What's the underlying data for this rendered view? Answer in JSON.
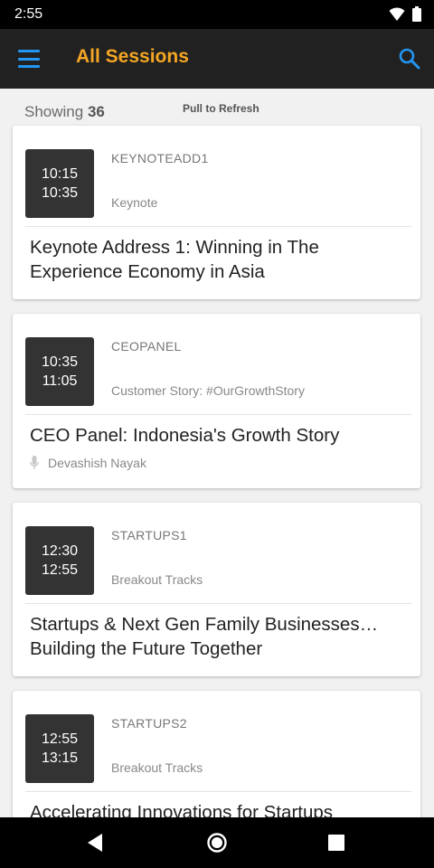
{
  "status": {
    "time": "2:55"
  },
  "app": {
    "title": "All Sessions"
  },
  "list": {
    "showing_label": "Showing",
    "count": "36",
    "pull_refresh": "Pull to Refresh"
  },
  "sessions": [
    {
      "start": "10:15",
      "end": "10:35",
      "code": "KEYNOTEADD1",
      "track": "Keynote",
      "title": "Keynote Address 1: Winning in The Experience Economy in Asia",
      "speaker": ""
    },
    {
      "start": "10:35",
      "end": "11:05",
      "code": "CEOPANEL",
      "track": "Customer Story: #OurGrowthStory",
      "title": "CEO Panel: Indonesia's Growth Story",
      "speaker": "Devashish Nayak"
    },
    {
      "start": "12:30",
      "end": "12:55",
      "code": "STARTUPS1",
      "track": "Breakout Tracks",
      "title": "Startups & Next Gen Family Businesses… Building the Future Together",
      "speaker": ""
    },
    {
      "start": "12:55",
      "end": "13:15",
      "code": "STARTUPS2",
      "track": "Breakout Tracks",
      "title": "Accelerating Innovations for Startups",
      "speaker": ""
    }
  ],
  "colors": {
    "accent": "#2196f3",
    "title": "#f5a623",
    "app_bar": "#212121",
    "time_box": "#333333"
  }
}
